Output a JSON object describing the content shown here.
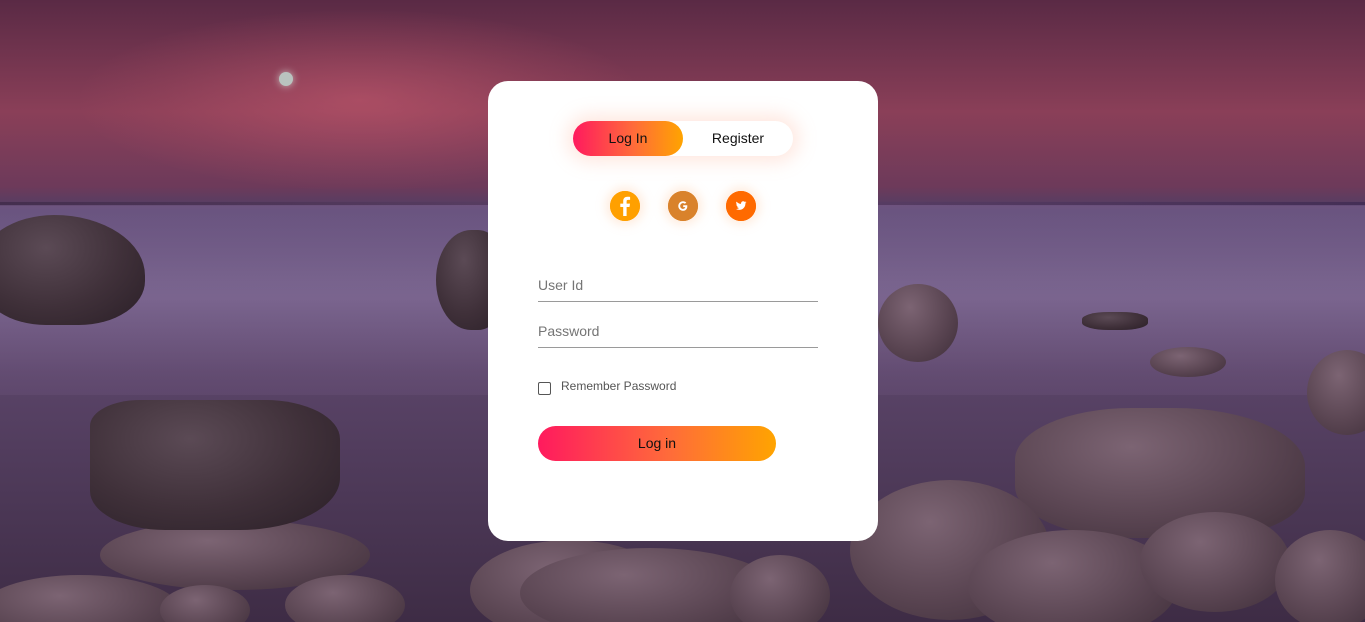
{
  "tabs": {
    "login_label": "Log In",
    "register_label": "Register",
    "active": "login"
  },
  "social": [
    {
      "name": "facebook-icon",
      "glyph": "f",
      "color": "#ffa000"
    },
    {
      "name": "google-icon",
      "glyph": "G",
      "color": "#d9822b"
    },
    {
      "name": "twitter-icon",
      "glyph": "bird",
      "color": "#ff6a00"
    }
  ],
  "form": {
    "user_id_placeholder": "User Id",
    "user_id_value": "",
    "password_placeholder": "Password",
    "password_value": "",
    "remember_label": "Remember Password",
    "remember_checked": false,
    "submit_label": "Log in"
  },
  "colors": {
    "gradient_start": "#ff1a5e",
    "gradient_end": "#ffa400",
    "card_background": "#ffffff"
  }
}
